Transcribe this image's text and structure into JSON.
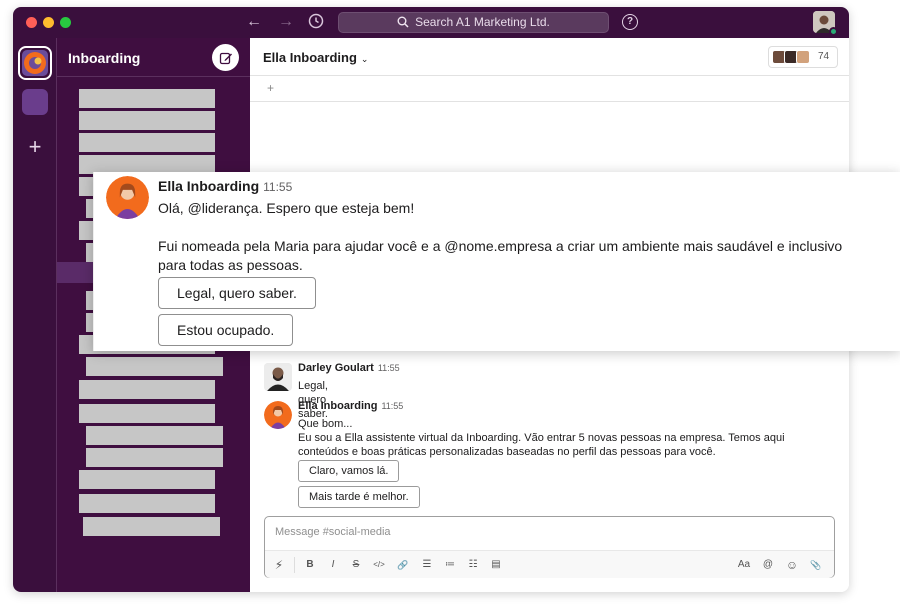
{
  "window": {
    "search_placeholder": "Search A1 Marketing Ltd.",
    "help_label": "?"
  },
  "rail": {
    "add_label": "+"
  },
  "sidebar": {
    "title": "Inboarding"
  },
  "channel": {
    "name": "Ella Inboarding",
    "member_count": "74",
    "bookmark_add": "+"
  },
  "messages": [
    {
      "author": "Darley Goulart",
      "time": "11:55",
      "text": "Legal, quero saber."
    },
    {
      "author": "Ella Inboarding",
      "time": "11:55",
      "line1": "Que bom...",
      "line2": "Eu sou a Ella assistente virtual da Inboarding. Vão entrar 5 novas pessoas na empresa. Temos aqui conteúdos e boas práticas personalizadas baseadas no perfil das pessoas para você.",
      "buttons": [
        "Claro, vamos lá.",
        "Mais tarde é melhor."
      ]
    }
  ],
  "composer": {
    "placeholder": "Message #social-media",
    "tools": {
      "shortcuts": "⚡",
      "bold": "B",
      "italic": "I",
      "strike": "S",
      "code": "</>",
      "link": "🔗",
      "ordered": "☰",
      "bullets": "≔",
      "numbered": "☷",
      "codeblock": "▤",
      "format": "Aa",
      "mention": "@",
      "emoji": "☺",
      "attach": "📎"
    }
  },
  "overlay": {
    "author": "Ella Inboarding",
    "time": "11:55",
    "greeting": "Olá, @liderança. Espero que esteja bem!",
    "body_line1": "Fui nomeada pela Maria para ajudar você e a @nome.empresa a criar um ambiente mais saudável e inclusivo",
    "body_line2": "para todas as pessoas.",
    "buttons": [
      "Legal, quero saber.",
      "Estou ocupado."
    ]
  },
  "colors": {
    "sidebar": "#3f0e40",
    "titlebar": "#3a0f3d",
    "placeholder_block": "#c6c6c6",
    "ella_orange": "#f26b1d",
    "ella_purple": "#7b3fa0"
  }
}
